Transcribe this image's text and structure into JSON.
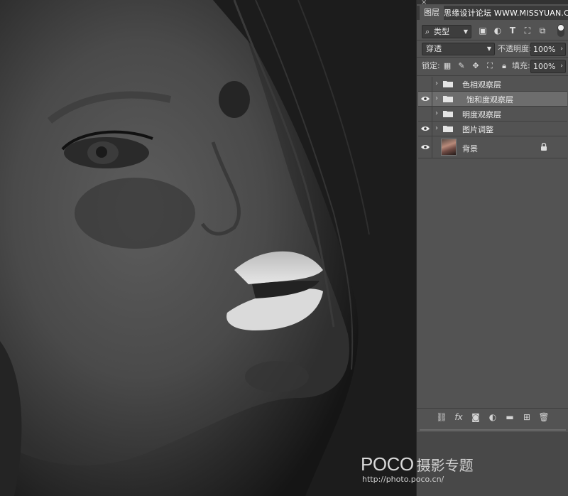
{
  "panel": {
    "close_glyph": "×",
    "tab_label": "图层",
    "watermark_top": "思缘设计论坛 WWW.MISSYUAN.COM",
    "filter": {
      "kind_label": "类型",
      "icons": [
        "image-filter-icon",
        "adjustment-filter-icon",
        "type-filter-icon",
        "shape-filter-icon",
        "smart-object-filter-icon"
      ]
    },
    "blend_mode": "穿透",
    "opacity_label": "不透明度:",
    "opacity_value": "100%",
    "lock_label": "锁定:",
    "fill_label": "填充:",
    "fill_value": "100%",
    "layers": [
      {
        "name": "色相观察层",
        "visible": false,
        "type": "group",
        "selected": false
      },
      {
        "name": "饱和度观察层",
        "visible": true,
        "type": "group",
        "selected": true
      },
      {
        "name": "明度观察层",
        "visible": false,
        "type": "group",
        "selected": false
      },
      {
        "name": "图片调整",
        "visible": true,
        "type": "group",
        "selected": false
      },
      {
        "name": "背景",
        "visible": true,
        "type": "image",
        "locked": true,
        "selected": false
      }
    ],
    "bottom_icons": [
      "link-layers-icon",
      "fx-icon",
      "add-mask-icon",
      "new-group-icon",
      "adjustment-layer-icon",
      "new-layer-icon",
      "trash-icon"
    ]
  },
  "watermark": {
    "brand": "POCO",
    "title": "摄影专题",
    "url": "http://photo.poco.cn/"
  },
  "colors": {
    "panel_bg": "#535353",
    "selected_layer": "#6d6d6d",
    "canvas_bg": "#1a1a1a"
  }
}
